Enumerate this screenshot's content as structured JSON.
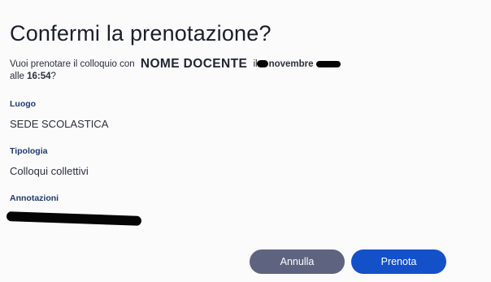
{
  "dialog": {
    "title": "Confermi la prenotazione?",
    "question": {
      "prefix": "Vuoi prenotare il colloquio con",
      "teacher": "NOME DOCENTE",
      "il": "il",
      "month": "novembre",
      "alle": "alle",
      "time": "16:54",
      "suffix": "?"
    },
    "fields": {
      "luogo_label": "Luogo",
      "luogo_value": "SEDE SCOLASTICA",
      "tipologia_label": "Tipologia",
      "tipologia_value": "Colloqui collettivi",
      "annotazioni_label": "Annotazioni"
    },
    "buttons": {
      "cancel": "Annulla",
      "confirm": "Prenota"
    },
    "colors": {
      "confirm": "#1450c8",
      "cancel": "#5e6480",
      "label": "#203a6e"
    }
  }
}
